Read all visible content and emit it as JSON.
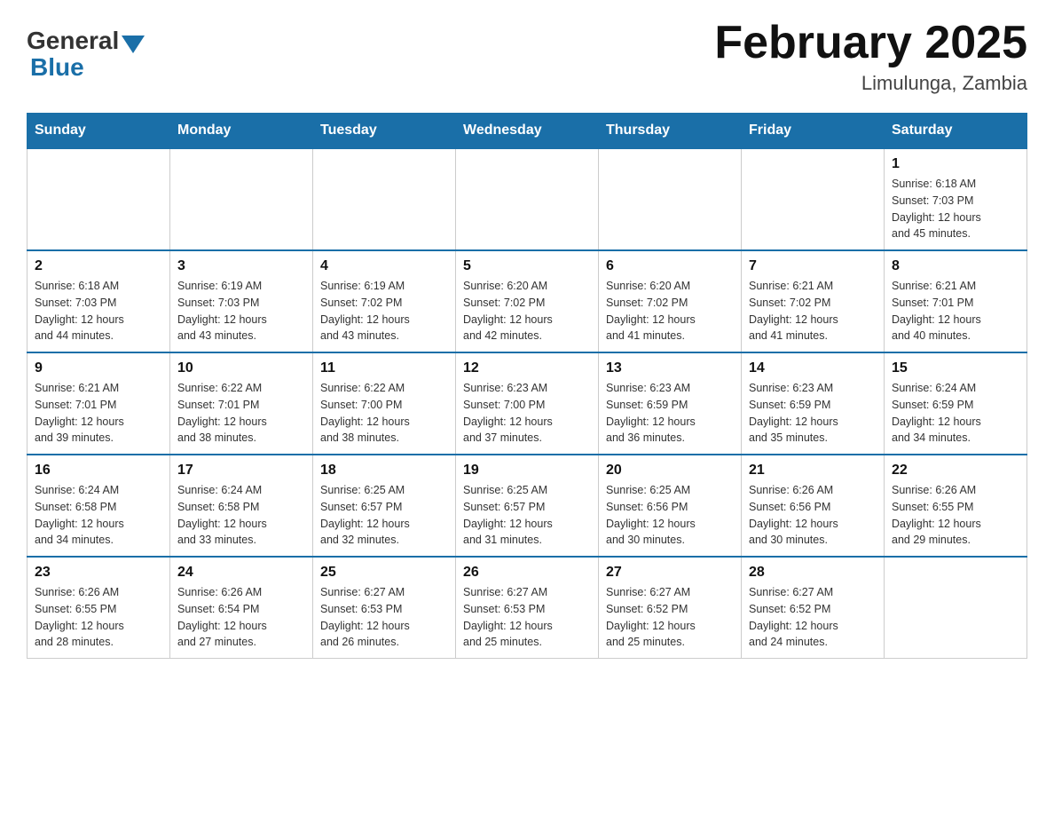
{
  "header": {
    "logo": {
      "general": "General",
      "blue": "Blue"
    },
    "title": "February 2025",
    "location": "Limulunga, Zambia"
  },
  "weekdays": [
    "Sunday",
    "Monday",
    "Tuesday",
    "Wednesday",
    "Thursday",
    "Friday",
    "Saturday"
  ],
  "weeks": [
    [
      {
        "day": "",
        "info": ""
      },
      {
        "day": "",
        "info": ""
      },
      {
        "day": "",
        "info": ""
      },
      {
        "day": "",
        "info": ""
      },
      {
        "day": "",
        "info": ""
      },
      {
        "day": "",
        "info": ""
      },
      {
        "day": "1",
        "info": "Sunrise: 6:18 AM\nSunset: 7:03 PM\nDaylight: 12 hours\nand 45 minutes."
      }
    ],
    [
      {
        "day": "2",
        "info": "Sunrise: 6:18 AM\nSunset: 7:03 PM\nDaylight: 12 hours\nand 44 minutes."
      },
      {
        "day": "3",
        "info": "Sunrise: 6:19 AM\nSunset: 7:03 PM\nDaylight: 12 hours\nand 43 minutes."
      },
      {
        "day": "4",
        "info": "Sunrise: 6:19 AM\nSunset: 7:02 PM\nDaylight: 12 hours\nand 43 minutes."
      },
      {
        "day": "5",
        "info": "Sunrise: 6:20 AM\nSunset: 7:02 PM\nDaylight: 12 hours\nand 42 minutes."
      },
      {
        "day": "6",
        "info": "Sunrise: 6:20 AM\nSunset: 7:02 PM\nDaylight: 12 hours\nand 41 minutes."
      },
      {
        "day": "7",
        "info": "Sunrise: 6:21 AM\nSunset: 7:02 PM\nDaylight: 12 hours\nand 41 minutes."
      },
      {
        "day": "8",
        "info": "Sunrise: 6:21 AM\nSunset: 7:01 PM\nDaylight: 12 hours\nand 40 minutes."
      }
    ],
    [
      {
        "day": "9",
        "info": "Sunrise: 6:21 AM\nSunset: 7:01 PM\nDaylight: 12 hours\nand 39 minutes."
      },
      {
        "day": "10",
        "info": "Sunrise: 6:22 AM\nSunset: 7:01 PM\nDaylight: 12 hours\nand 38 minutes."
      },
      {
        "day": "11",
        "info": "Sunrise: 6:22 AM\nSunset: 7:00 PM\nDaylight: 12 hours\nand 38 minutes."
      },
      {
        "day": "12",
        "info": "Sunrise: 6:23 AM\nSunset: 7:00 PM\nDaylight: 12 hours\nand 37 minutes."
      },
      {
        "day": "13",
        "info": "Sunrise: 6:23 AM\nSunset: 6:59 PM\nDaylight: 12 hours\nand 36 minutes."
      },
      {
        "day": "14",
        "info": "Sunrise: 6:23 AM\nSunset: 6:59 PM\nDaylight: 12 hours\nand 35 minutes."
      },
      {
        "day": "15",
        "info": "Sunrise: 6:24 AM\nSunset: 6:59 PM\nDaylight: 12 hours\nand 34 minutes."
      }
    ],
    [
      {
        "day": "16",
        "info": "Sunrise: 6:24 AM\nSunset: 6:58 PM\nDaylight: 12 hours\nand 34 minutes."
      },
      {
        "day": "17",
        "info": "Sunrise: 6:24 AM\nSunset: 6:58 PM\nDaylight: 12 hours\nand 33 minutes."
      },
      {
        "day": "18",
        "info": "Sunrise: 6:25 AM\nSunset: 6:57 PM\nDaylight: 12 hours\nand 32 minutes."
      },
      {
        "day": "19",
        "info": "Sunrise: 6:25 AM\nSunset: 6:57 PM\nDaylight: 12 hours\nand 31 minutes."
      },
      {
        "day": "20",
        "info": "Sunrise: 6:25 AM\nSunset: 6:56 PM\nDaylight: 12 hours\nand 30 minutes."
      },
      {
        "day": "21",
        "info": "Sunrise: 6:26 AM\nSunset: 6:56 PM\nDaylight: 12 hours\nand 30 minutes."
      },
      {
        "day": "22",
        "info": "Sunrise: 6:26 AM\nSunset: 6:55 PM\nDaylight: 12 hours\nand 29 minutes."
      }
    ],
    [
      {
        "day": "23",
        "info": "Sunrise: 6:26 AM\nSunset: 6:55 PM\nDaylight: 12 hours\nand 28 minutes."
      },
      {
        "day": "24",
        "info": "Sunrise: 6:26 AM\nSunset: 6:54 PM\nDaylight: 12 hours\nand 27 minutes."
      },
      {
        "day": "25",
        "info": "Sunrise: 6:27 AM\nSunset: 6:53 PM\nDaylight: 12 hours\nand 26 minutes."
      },
      {
        "day": "26",
        "info": "Sunrise: 6:27 AM\nSunset: 6:53 PM\nDaylight: 12 hours\nand 25 minutes."
      },
      {
        "day": "27",
        "info": "Sunrise: 6:27 AM\nSunset: 6:52 PM\nDaylight: 12 hours\nand 25 minutes."
      },
      {
        "day": "28",
        "info": "Sunrise: 6:27 AM\nSunset: 6:52 PM\nDaylight: 12 hours\nand 24 minutes."
      },
      {
        "day": "",
        "info": ""
      }
    ]
  ]
}
